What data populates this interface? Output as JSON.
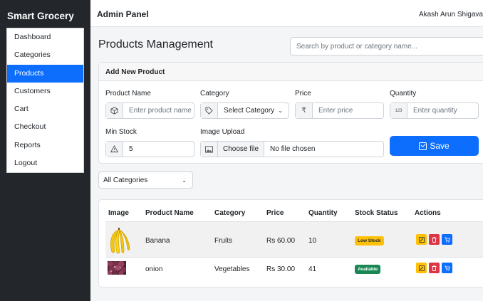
{
  "brand": "Smart Grocery",
  "nav": {
    "items": [
      {
        "label": "Dashboard"
      },
      {
        "label": "Categories"
      },
      {
        "label": "Products"
      },
      {
        "label": "Customers"
      },
      {
        "label": "Cart"
      },
      {
        "label": "Checkout"
      },
      {
        "label": "Reports"
      },
      {
        "label": "Logout"
      }
    ],
    "active": "Products"
  },
  "topbar": {
    "title": "Admin Panel",
    "user": "Akash Arun Shigava"
  },
  "page": {
    "title": "Products Management",
    "search_placeholder": "Search by product or category name..."
  },
  "form": {
    "header": "Add New Product",
    "product_name": {
      "label": "Product Name",
      "placeholder": "Enter product name",
      "icon": "box-icon"
    },
    "category": {
      "label": "Category",
      "value": "Select Category",
      "icon": "tag-icon"
    },
    "price": {
      "label": "Price",
      "placeholder": "Enter price",
      "icon": "rupee-icon",
      "icon_glyph": "₹"
    },
    "quantity": {
      "label": "Quantity",
      "placeholder": "Enter quantity",
      "icon": "numbers-icon",
      "icon_glyph": "123"
    },
    "min_stock": {
      "label": "Min Stock",
      "value": "5",
      "icon": "warning-icon"
    },
    "image_upload": {
      "label": "Image Upload",
      "button": "Choose file",
      "status": "No file chosen",
      "icon": "image-icon"
    },
    "save_label": "Save"
  },
  "filter": {
    "value": "All Categories"
  },
  "table": {
    "headers": {
      "image": "Image",
      "name": "Product Name",
      "category": "Category",
      "price": "Price",
      "quantity": "Quantity",
      "status": "Stock Status",
      "actions": "Actions"
    },
    "rows": [
      {
        "name": "Banana",
        "category": "Fruits",
        "price": "Rs 60.00",
        "quantity": "10",
        "status": "Low Stock",
        "status_color": "#ffc107"
      },
      {
        "name": "onion",
        "category": "Vegetables",
        "price": "Rs 30.00",
        "quantity": "41",
        "status": "Available",
        "status_color": "#198754"
      }
    ]
  },
  "colors": {
    "primary": "#0d6efd",
    "sidebar": "#23272c",
    "warning": "#ffc107",
    "danger": "#dc3545",
    "success": "#198754"
  }
}
